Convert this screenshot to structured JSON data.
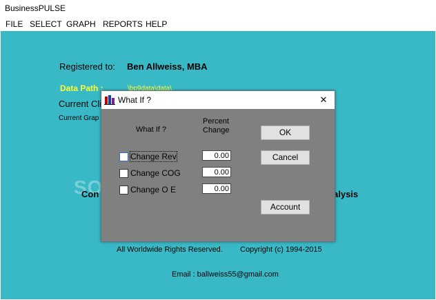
{
  "window": {
    "title": "BusinessPULSE"
  },
  "menu": {
    "file": "FILE",
    "select": "SELECT",
    "graph": "GRAPH",
    "reports": "REPORTS",
    "help": "HELP"
  },
  "main": {
    "registered_label": "Registered to:",
    "registered_name": "Ben Allweiss, MBA",
    "data_path_label": "Data Path :",
    "data_path_value": "\\bp9data\\data\\",
    "current_client": "Current Cli",
    "current_graph": "Current Grap",
    "con": "Con",
    "alysis": "alysis",
    "rights": "All Worldwide Rights Reserved.",
    "copyright": "Copyright (c) 1994-2015",
    "email": "Email :  ballweiss55@gmail.com",
    "watermark": "SOFTPEDIA"
  },
  "dialog": {
    "title": "What If ?",
    "close": "✕",
    "header_whatif": "What If ?",
    "header_percent_1": "Percent",
    "header_percent_2": "Change",
    "rows": [
      {
        "label": "Change Rev",
        "value": "0.00"
      },
      {
        "label": "Change COG",
        "value": "0.00"
      },
      {
        "label": "Change O E",
        "value": "0.00"
      }
    ],
    "ok": "OK",
    "cancel": "Cancel",
    "account": "Account"
  },
  "colors": {
    "background": "#39b9c6",
    "data_path": "#ffff33",
    "dialog_body": "#808080"
  }
}
